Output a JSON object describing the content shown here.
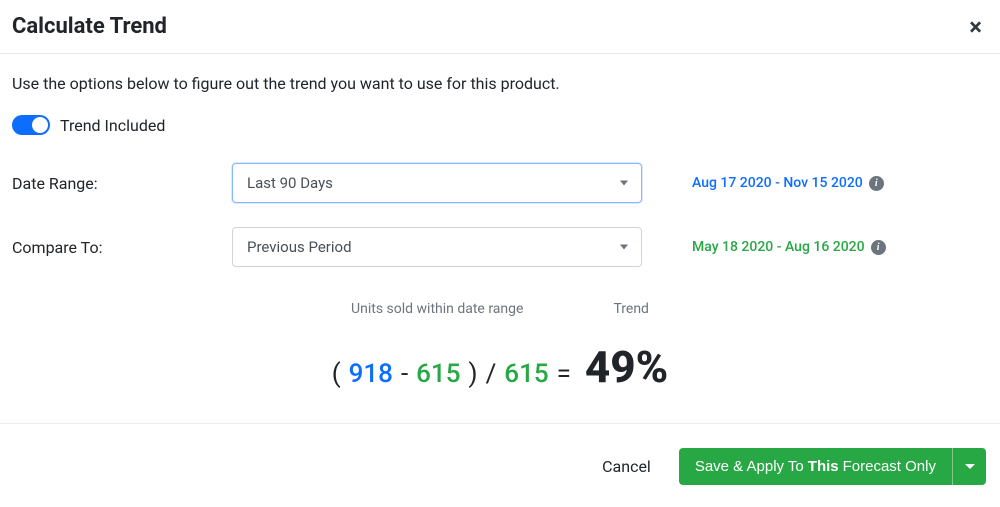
{
  "header": {
    "title": "Calculate Trend"
  },
  "body": {
    "description": "Use the options below to figure out the trend you want to use for this product.",
    "toggle": {
      "label": "Trend Included"
    },
    "row1": {
      "label": "Date Range:",
      "value": "Last 90 Days",
      "range": "Aug 17 2020 - Nov 15 2020"
    },
    "row2": {
      "label": "Compare To:",
      "value": "Previous Period",
      "range": "May 18 2020 - Aug 16 2020"
    },
    "calc": {
      "labels": {
        "units": "Units sold within date range",
        "trend": "Trend"
      },
      "paren_open": "(",
      "val1": "918",
      "minus": "-",
      "val2": "615",
      "paren_close": ")",
      "divide": "/",
      "val3": "615",
      "equals": "=",
      "percent": "49%"
    }
  },
  "footer": {
    "cancel": "Cancel",
    "save_prefix": "Save & Apply To ",
    "save_bold": "This",
    "save_suffix": " Forecast Only"
  }
}
